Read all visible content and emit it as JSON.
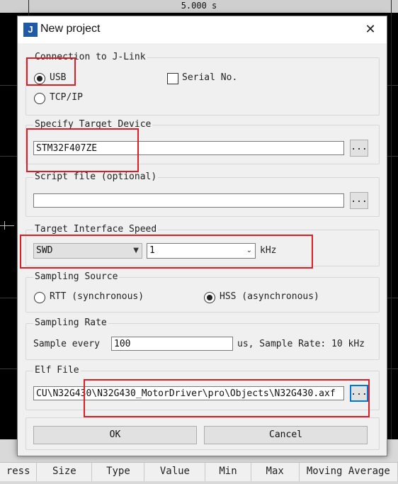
{
  "background": {
    "time_label": "5.000 s",
    "columns": [
      "ress",
      "Size",
      "Type",
      "Value",
      "Min",
      "Max",
      "Moving Average"
    ]
  },
  "dialog": {
    "title": "New project",
    "icon_glyph": "J",
    "close_glyph": "✕",
    "connection": {
      "label": "Connection to J-Link",
      "usb": "USB",
      "serial": "Serial No.",
      "tcpip": "TCP/IP",
      "selected": "USB"
    },
    "target": {
      "label": "Specify Target Device",
      "value": "STM32F407ZE",
      "browse": "..."
    },
    "script": {
      "label": "Script file (optional)",
      "value": "",
      "browse": "..."
    },
    "interface": {
      "label": "Target Interface  Speed",
      "interface_value": "SWD",
      "speed_value": "1",
      "unit": "kHz"
    },
    "sampling_source": {
      "label": "Sampling Source",
      "rtt": "RTT (synchronous)",
      "hss": "HSS (asynchronous)",
      "selected": "HSS"
    },
    "sampling_rate": {
      "label": "Sampling Rate",
      "prefix": "Sample every",
      "value": "100",
      "suffix": "us, Sample Rate: 10 kHz"
    },
    "elf": {
      "label": "Elf File",
      "value": "CU\\N32G430\\N32G430_MotorDriver\\pro\\Objects\\N32G430.axf",
      "browse": "..."
    },
    "ok": "OK",
    "cancel": "Cancel"
  },
  "colors": {
    "highlight": "#e01c24",
    "focus": "#0078d7"
  }
}
